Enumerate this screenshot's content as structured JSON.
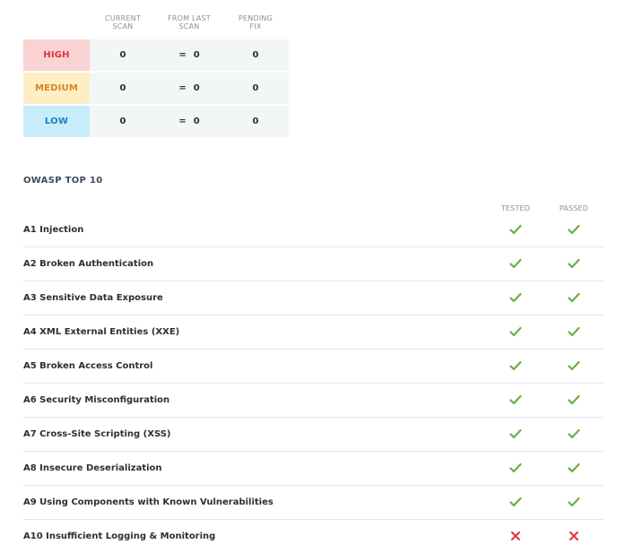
{
  "summary": {
    "columns": [
      "CURRENT\nSCAN",
      "FROM LAST\nSCAN",
      "PENDING\nFIX"
    ],
    "rows": [
      {
        "label": "HIGH",
        "current": "0",
        "from_last_symbol": "=",
        "from_last": "0",
        "pending": "0"
      },
      {
        "label": "MEDIUM",
        "current": "0",
        "from_last_symbol": "=",
        "from_last": "0",
        "pending": "0"
      },
      {
        "label": "LOW",
        "current": "0",
        "from_last_symbol": "=",
        "from_last": "0",
        "pending": "0"
      }
    ],
    "colors": {
      "high": "#d9333f",
      "medium": "#d9841b",
      "low": "#1e7fc0"
    }
  },
  "owasp": {
    "title": "OWASP TOP 10",
    "columns": {
      "tested": "TESTED",
      "passed": "PASSED"
    },
    "items": [
      {
        "name": "A1 Injection",
        "tested": "check-icon",
        "passed": "check-icon"
      },
      {
        "name": "A2 Broken Authentication",
        "tested": "check-icon",
        "passed": "check-icon"
      },
      {
        "name": "A3 Sensitive Data Exposure",
        "tested": "check-icon",
        "passed": "check-icon"
      },
      {
        "name": "A4 XML External Entities (XXE)",
        "tested": "check-icon",
        "passed": "check-icon"
      },
      {
        "name": "A5 Broken Access Control",
        "tested": "check-icon",
        "passed": "check-icon"
      },
      {
        "name": "A6 Security Misconfiguration",
        "tested": "check-icon",
        "passed": "check-icon"
      },
      {
        "name": "A7 Cross-Site Scripting (XSS)",
        "tested": "check-icon",
        "passed": "check-icon"
      },
      {
        "name": "A8 Insecure Deserialization",
        "tested": "check-icon",
        "passed": "check-icon"
      },
      {
        "name": "A9 Using Components with Known Vulnerabilities",
        "tested": "check-icon",
        "passed": "check-icon"
      },
      {
        "name": "A10 Insufficient Logging & Monitoring",
        "tested": "cross-icon",
        "passed": "cross-icon"
      }
    ],
    "colors": {
      "check": "#6ab041",
      "cross": "#e0363c"
    }
  }
}
